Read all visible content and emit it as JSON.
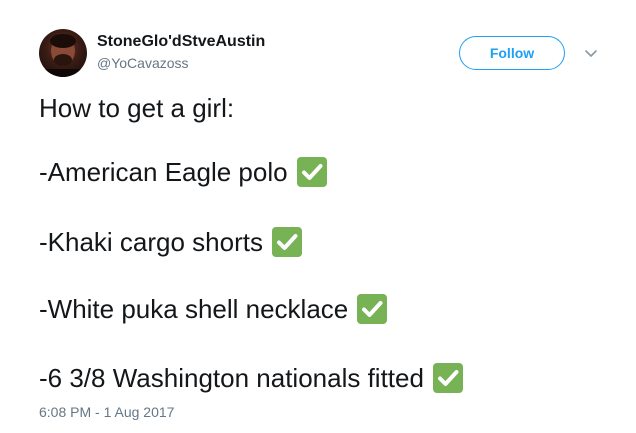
{
  "author": {
    "display_name": "StoneGlo'dStveAustin",
    "handle": "@YoCavazoss"
  },
  "follow_label": "Follow",
  "tweet": {
    "lines": [
      {
        "text": "How to get a girl:",
        "checked": false
      },
      {
        "text": "-American Eagle polo",
        "checked": true
      },
      {
        "text": "-Khaki cargo shorts",
        "checked": true
      },
      {
        "text": "-White puka shell necklace",
        "checked": true
      },
      {
        "text": "-6 3/8 Washington nationals fitted",
        "checked": true
      }
    ]
  },
  "timestamp": "6:08 PM - 1 Aug 2017",
  "icons": {
    "check": "white-heavy-check-mark-icon",
    "more": "chevron-down-icon"
  },
  "colors": {
    "accent": "#1da1f2",
    "check_green": "#77b255",
    "secondary_text": "#657786"
  }
}
